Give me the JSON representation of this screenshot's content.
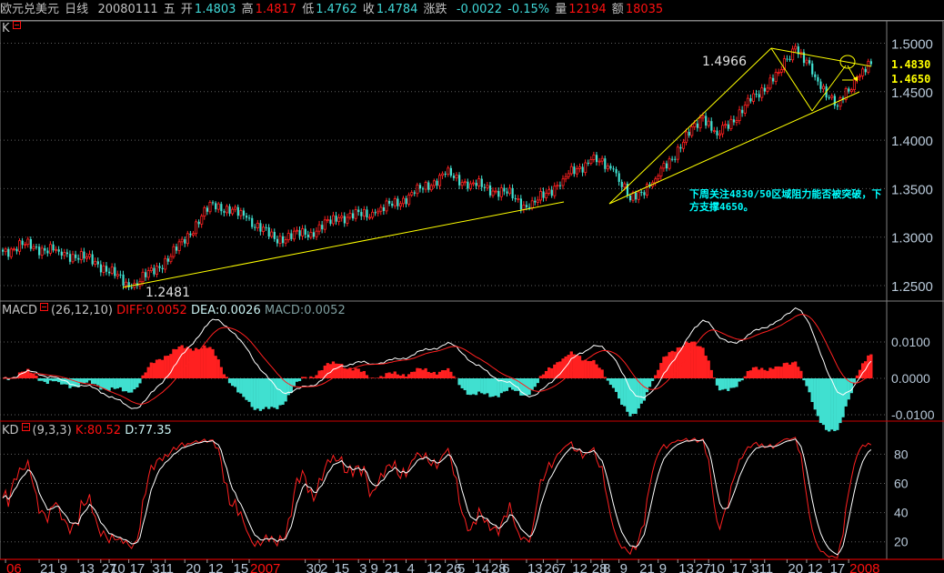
{
  "header": {
    "symbol": "欧元兑美元",
    "period": "日线",
    "date": "20080111",
    "weekday": "五",
    "open_label": "开",
    "open": "1.4803",
    "high_label": "高",
    "high": "1.4817",
    "low_label": "低",
    "low": "1.4762",
    "close_label": "收",
    "close": "1.4784",
    "change_label": "涨跌",
    "change": "-0.0022",
    "change_pct": "-0.15%",
    "volume_label": "量",
    "volume": "12194",
    "amount_label": "额",
    "amount": "18035"
  },
  "main_panel": {
    "title": "K",
    "high_mark": "1.4966",
    "low_mark": "1.2481",
    "resistance": "1.4830",
    "support": "1.4650",
    "note": "下周关注4830/50区域阻力能否被突破，下方支撑4650。"
  },
  "macd_panel": {
    "title": "MACD",
    "params": "(26,12,10)",
    "diff": "DIFF:0.0052",
    "dea": "DEA:0.0026",
    "macd": "MACD:0.0052"
  },
  "kd_panel": {
    "title": "KD",
    "params": "(9,3,3)",
    "k": "K:80.52",
    "d": "D:77.35"
  },
  "colors": {
    "up": "#ff2020",
    "down": "#40e0d0",
    "trend": "#ffff00",
    "grid": "#606060"
  },
  "chart_data": {
    "type": "candlestick",
    "price_ticks": [
      "1.5000",
      "1.4500",
      "1.4000",
      "1.3500",
      "1.3000",
      "1.2500"
    ],
    "price_ylim": [
      1.235,
      1.522
    ],
    "close_pivots": [
      [
        0,
        1.285
      ],
      [
        7,
        1.292
      ],
      [
        20,
        1.285
      ],
      [
        33,
        1.275
      ],
      [
        46,
        1.2481
      ],
      [
        60,
        1.28
      ],
      [
        75,
        1.335
      ],
      [
        87,
        1.32
      ],
      [
        97,
        1.298
      ],
      [
        110,
        1.305
      ],
      [
        120,
        1.32
      ],
      [
        133,
        1.325
      ],
      [
        147,
        1.345
      ],
      [
        158,
        1.365
      ],
      [
        167,
        1.355
      ],
      [
        180,
        1.345
      ],
      [
        188,
        1.33
      ],
      [
        200,
        1.36
      ],
      [
        210,
        1.38
      ],
      [
        218,
        1.37
      ],
      [
        224,
        1.338
      ],
      [
        233,
        1.36
      ],
      [
        250,
        1.425
      ],
      [
        255,
        1.405
      ],
      [
        267,
        1.44
      ],
      [
        277,
        1.47
      ],
      [
        283,
        1.4966
      ],
      [
        290,
        1.465
      ],
      [
        298,
        1.435
      ],
      [
        305,
        1.465
      ],
      [
        310,
        1.4784
      ]
    ],
    "macd_ticks": [
      "0.0100",
      "0.0000",
      "-0.0100"
    ],
    "macd_ylim": [
      -0.0115,
      0.0165
    ],
    "kd_ticks": [
      "80",
      "60",
      "40",
      "20"
    ],
    "kd_ylim": [
      8,
      102
    ],
    "date_labels": [
      [
        "06",
        1,
        true
      ],
      [
        "21",
        13
      ],
      [
        "9",
        20
      ],
      [
        "13",
        27
      ],
      [
        "27",
        35
      ],
      [
        "10",
        38
      ],
      [
        "17",
        45
      ],
      [
        "31",
        53
      ],
      [
        "1",
        58
      ],
      [
        "20",
        65
      ],
      [
        "12",
        73
      ],
      [
        "15",
        82
      ],
      [
        "2007",
        88,
        true
      ],
      [
        "30",
        108
      ],
      [
        "2",
        113
      ],
      [
        "15",
        118
      ],
      [
        "3",
        127
      ],
      [
        "9",
        131
      ],
      [
        "21",
        136
      ],
      [
        "4",
        144
      ],
      [
        "12",
        151
      ],
      [
        "26",
        158
      ],
      [
        "5",
        162
      ],
      [
        "14",
        168
      ],
      [
        "28",
        174
      ],
      [
        "6",
        178
      ],
      [
        "13",
        187
      ],
      [
        "26",
        193
      ],
      [
        "7",
        198
      ],
      [
        "12",
        203
      ],
      [
        "28",
        210
      ],
      [
        "8",
        214
      ],
      [
        "9",
        220
      ],
      [
        "21",
        227
      ],
      [
        "9",
        234
      ],
      [
        "13",
        241
      ],
      [
        "27",
        247
      ],
      [
        "10",
        252
      ],
      [
        "17",
        260
      ],
      [
        "31",
        267
      ],
      [
        "1",
        272
      ],
      [
        "20",
        280
      ],
      [
        "12",
        287
      ],
      [
        "17",
        295
      ],
      [
        "2008",
        302,
        true
      ]
    ]
  }
}
